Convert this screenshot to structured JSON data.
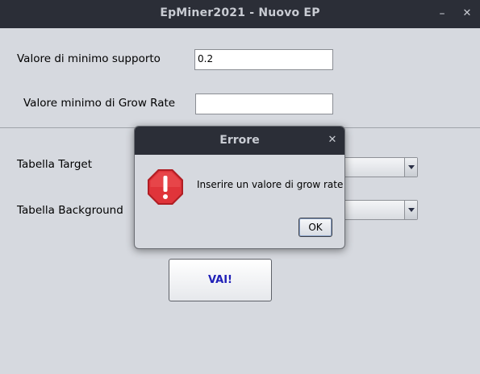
{
  "window": {
    "title": "EpMiner2021 - Nuovo EP",
    "minimize_glyph": "–",
    "close_glyph": "✕"
  },
  "form": {
    "min_support_label": "Valore di minimo supporto",
    "min_support_value": "0.2",
    "min_grow_rate_label": "Valore minimo di Grow Rate",
    "min_grow_rate_value": "",
    "target_table_label": "Tabella Target",
    "background_table_label": "Tabella Background",
    "go_button_label": "VAI!"
  },
  "dialog": {
    "title": "Errore",
    "close_glyph": "✕",
    "icon": "error-octagon-icon",
    "message": "Inserire un valore di grow rate",
    "ok_label": "OK"
  },
  "colors": {
    "titlebar_bg": "#2b2e37",
    "window_bg": "#d6d9df",
    "error_red": "#d9262c",
    "button_text_blue": "#2020b8"
  }
}
